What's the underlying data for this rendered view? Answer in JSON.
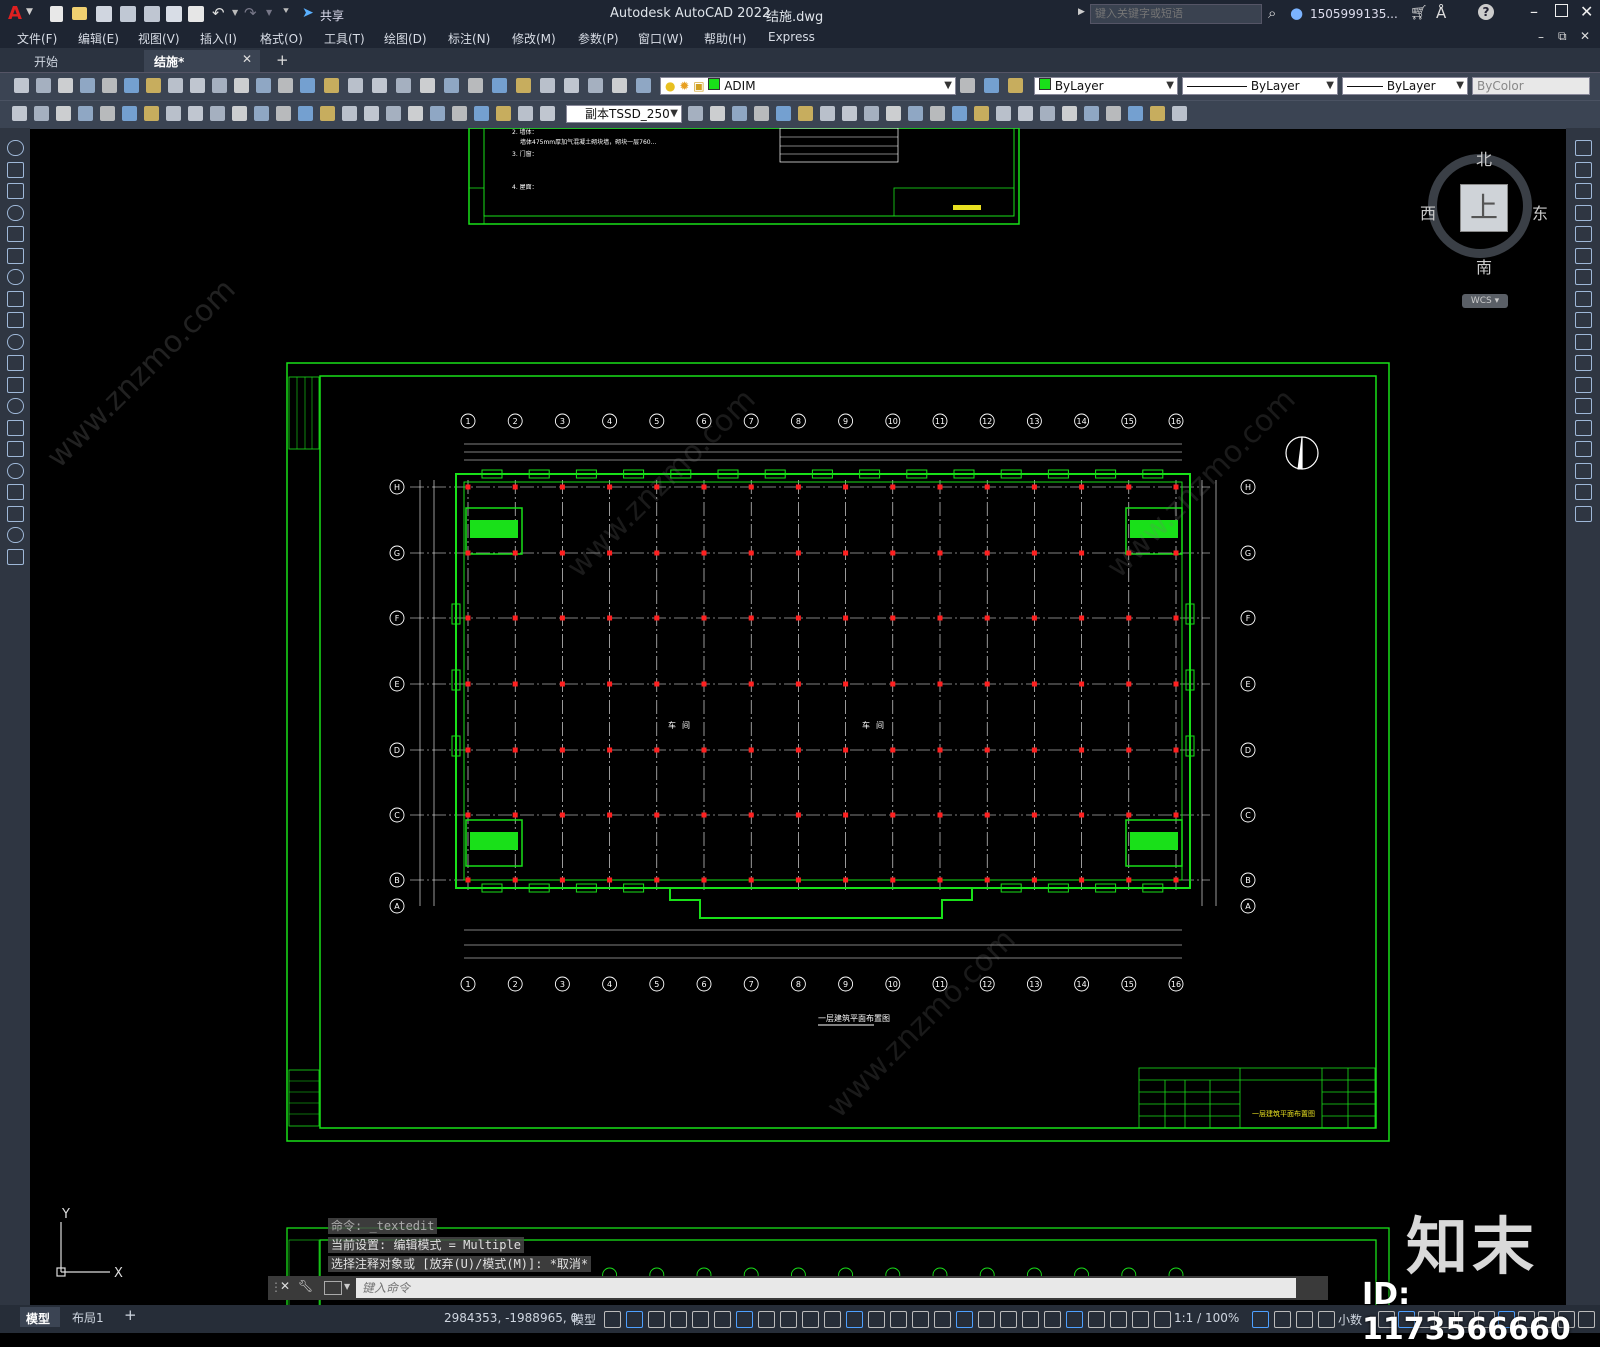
{
  "titlebar": {
    "app_title": "Autodesk AutoCAD 2022",
    "file_name": "结施.dwg",
    "share_label": "共享",
    "search_placeholder": "键入关键字或短语",
    "user_name": "1505999135...",
    "logo_letter": "A"
  },
  "menus": [
    "文件(F)",
    "编辑(E)",
    "视图(V)",
    "插入(I)",
    "格式(O)",
    "工具(T)",
    "绘图(D)",
    "标注(N)",
    "修改(M)",
    "参数(P)",
    "窗口(W)",
    "帮助(H)",
    "Express"
  ],
  "tabs": [
    {
      "label": "开始",
      "active": false
    },
    {
      "label": "结施*",
      "active": true
    }
  ],
  "toolbar": {
    "layer_name": "ADIM",
    "color_value": "ByLayer",
    "linetype_value": "ByLayer",
    "lineweight_value": "ByLayer",
    "plotstyle_value": "ByColor",
    "dimstyle_value": "副本TSSD_250"
  },
  "viewcube": {
    "north": "北",
    "south": "南",
    "east": "东",
    "west": "西",
    "face": "上",
    "ucs": "WCS"
  },
  "ucs_icon": {
    "x": "X",
    "y": "Y"
  },
  "drawing": {
    "sheet_title": "一层建筑平面布置图",
    "room_label_1": "车间",
    "room_label_2": "车间",
    "axis_numbers": [
      "1",
      "2",
      "3",
      "4",
      "5",
      "6",
      "7",
      "8",
      "9",
      "10",
      "11",
      "12",
      "13",
      "14",
      "15",
      "16"
    ],
    "axis_letters": [
      "H",
      "G",
      "F",
      "E",
      "D",
      "C",
      "B",
      "A"
    ],
    "notes": [
      "2. 墙体：",
      "墙体475mm厚加气混凝土砌块墙，砌块一层760...",
      "3. 门窗：",
      "4. 屋面："
    ]
  },
  "command": {
    "history": [
      "命令:  _textedit",
      "当前设置: 编辑模式 = Multiple",
      "选择注释对象或 [放弃(U)/模式(M)]: *取消*"
    ],
    "placeholder": "键入命令"
  },
  "status": {
    "layout_tabs": [
      "模型",
      "布局1"
    ],
    "coordinates": "2984353, -1988965, 0",
    "model_label": "模型",
    "scale": "1:1 / 100%",
    "units": "小数"
  },
  "watermark": {
    "brand": "知末",
    "id": "ID: 1173566660",
    "site": "www.znzmo.com"
  },
  "colors": {
    "bg": "#000000",
    "chrome": "#2f3642",
    "green_line": "#19e019",
    "red_dot": "#ff2020",
    "white_line": "#ffffff"
  }
}
